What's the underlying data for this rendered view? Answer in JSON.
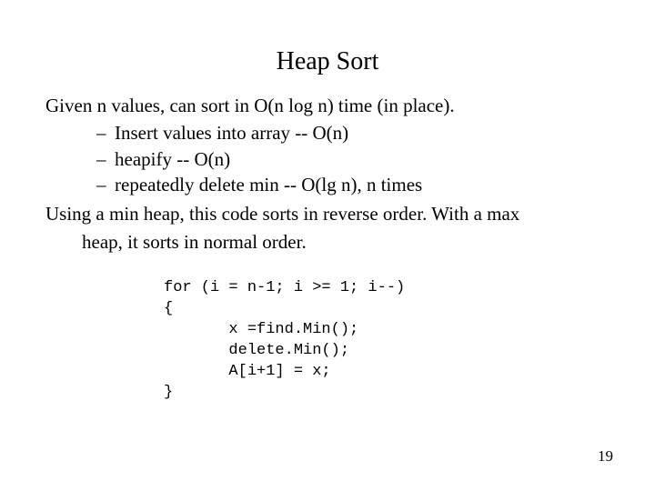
{
  "title": "Heap Sort",
  "intro": "Given n values, can sort in O(n log n) time (in place).",
  "bullets": [
    "Insert values into array  -- O(n)",
    "heapify -- O(n)",
    "repeatedly delete min -- O(lg n), n times"
  ],
  "closing_line1": "Using a min heap, this code sorts in reverse order. With a max",
  "closing_line2": "heap, it sorts in normal order.",
  "code": "for (i = n-1; i >= 1; i--)\n{\n       x =find.Min();\n       delete.Min();\n       A[i+1] = x;\n}",
  "page_number": "19"
}
